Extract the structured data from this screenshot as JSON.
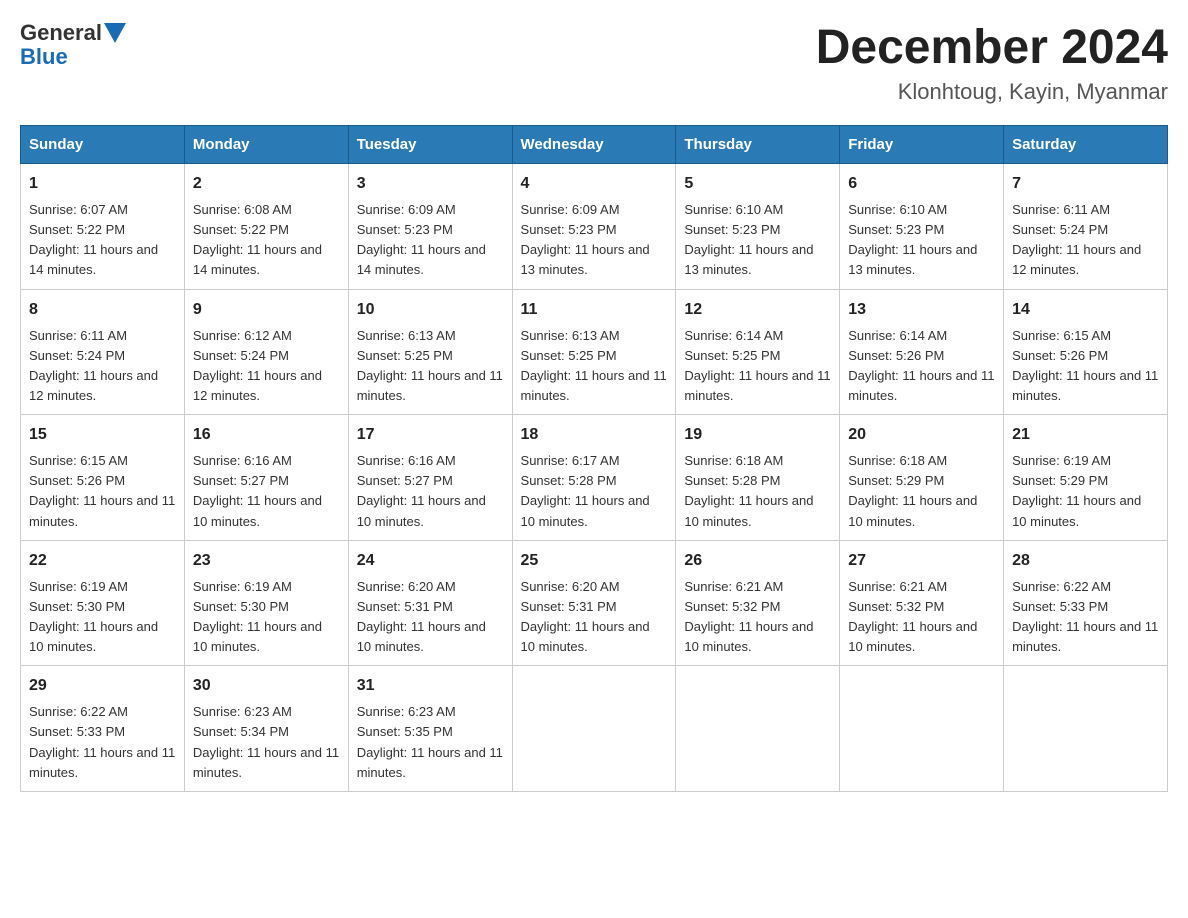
{
  "header": {
    "logo_general": "General",
    "logo_blue": "Blue",
    "month_title": "December 2024",
    "location": "Klonhtoug, Kayin, Myanmar"
  },
  "days_of_week": [
    "Sunday",
    "Monday",
    "Tuesday",
    "Wednesday",
    "Thursday",
    "Friday",
    "Saturday"
  ],
  "weeks": [
    [
      {
        "day": "1",
        "sunrise": "6:07 AM",
        "sunset": "5:22 PM",
        "daylight": "11 hours and 14 minutes."
      },
      {
        "day": "2",
        "sunrise": "6:08 AM",
        "sunset": "5:22 PM",
        "daylight": "11 hours and 14 minutes."
      },
      {
        "day": "3",
        "sunrise": "6:09 AM",
        "sunset": "5:23 PM",
        "daylight": "11 hours and 14 minutes."
      },
      {
        "day": "4",
        "sunrise": "6:09 AM",
        "sunset": "5:23 PM",
        "daylight": "11 hours and 13 minutes."
      },
      {
        "day": "5",
        "sunrise": "6:10 AM",
        "sunset": "5:23 PM",
        "daylight": "11 hours and 13 minutes."
      },
      {
        "day": "6",
        "sunrise": "6:10 AM",
        "sunset": "5:23 PM",
        "daylight": "11 hours and 13 minutes."
      },
      {
        "day": "7",
        "sunrise": "6:11 AM",
        "sunset": "5:24 PM",
        "daylight": "11 hours and 12 minutes."
      }
    ],
    [
      {
        "day": "8",
        "sunrise": "6:11 AM",
        "sunset": "5:24 PM",
        "daylight": "11 hours and 12 minutes."
      },
      {
        "day": "9",
        "sunrise": "6:12 AM",
        "sunset": "5:24 PM",
        "daylight": "11 hours and 12 minutes."
      },
      {
        "day": "10",
        "sunrise": "6:13 AM",
        "sunset": "5:25 PM",
        "daylight": "11 hours and 11 minutes."
      },
      {
        "day": "11",
        "sunrise": "6:13 AM",
        "sunset": "5:25 PM",
        "daylight": "11 hours and 11 minutes."
      },
      {
        "day": "12",
        "sunrise": "6:14 AM",
        "sunset": "5:25 PM",
        "daylight": "11 hours and 11 minutes."
      },
      {
        "day": "13",
        "sunrise": "6:14 AM",
        "sunset": "5:26 PM",
        "daylight": "11 hours and 11 minutes."
      },
      {
        "day": "14",
        "sunrise": "6:15 AM",
        "sunset": "5:26 PM",
        "daylight": "11 hours and 11 minutes."
      }
    ],
    [
      {
        "day": "15",
        "sunrise": "6:15 AM",
        "sunset": "5:26 PM",
        "daylight": "11 hours and 11 minutes."
      },
      {
        "day": "16",
        "sunrise": "6:16 AM",
        "sunset": "5:27 PM",
        "daylight": "11 hours and 10 minutes."
      },
      {
        "day": "17",
        "sunrise": "6:16 AM",
        "sunset": "5:27 PM",
        "daylight": "11 hours and 10 minutes."
      },
      {
        "day": "18",
        "sunrise": "6:17 AM",
        "sunset": "5:28 PM",
        "daylight": "11 hours and 10 minutes."
      },
      {
        "day": "19",
        "sunrise": "6:18 AM",
        "sunset": "5:28 PM",
        "daylight": "11 hours and 10 minutes."
      },
      {
        "day": "20",
        "sunrise": "6:18 AM",
        "sunset": "5:29 PM",
        "daylight": "11 hours and 10 minutes."
      },
      {
        "day": "21",
        "sunrise": "6:19 AM",
        "sunset": "5:29 PM",
        "daylight": "11 hours and 10 minutes."
      }
    ],
    [
      {
        "day": "22",
        "sunrise": "6:19 AM",
        "sunset": "5:30 PM",
        "daylight": "11 hours and 10 minutes."
      },
      {
        "day": "23",
        "sunrise": "6:19 AM",
        "sunset": "5:30 PM",
        "daylight": "11 hours and 10 minutes."
      },
      {
        "day": "24",
        "sunrise": "6:20 AM",
        "sunset": "5:31 PM",
        "daylight": "11 hours and 10 minutes."
      },
      {
        "day": "25",
        "sunrise": "6:20 AM",
        "sunset": "5:31 PM",
        "daylight": "11 hours and 10 minutes."
      },
      {
        "day": "26",
        "sunrise": "6:21 AM",
        "sunset": "5:32 PM",
        "daylight": "11 hours and 10 minutes."
      },
      {
        "day": "27",
        "sunrise": "6:21 AM",
        "sunset": "5:32 PM",
        "daylight": "11 hours and 10 minutes."
      },
      {
        "day": "28",
        "sunrise": "6:22 AM",
        "sunset": "5:33 PM",
        "daylight": "11 hours and 11 minutes."
      }
    ],
    [
      {
        "day": "29",
        "sunrise": "6:22 AM",
        "sunset": "5:33 PM",
        "daylight": "11 hours and 11 minutes."
      },
      {
        "day": "30",
        "sunrise": "6:23 AM",
        "sunset": "5:34 PM",
        "daylight": "11 hours and 11 minutes."
      },
      {
        "day": "31",
        "sunrise": "6:23 AM",
        "sunset": "5:35 PM",
        "daylight": "11 hours and 11 minutes."
      },
      null,
      null,
      null,
      null
    ]
  ]
}
